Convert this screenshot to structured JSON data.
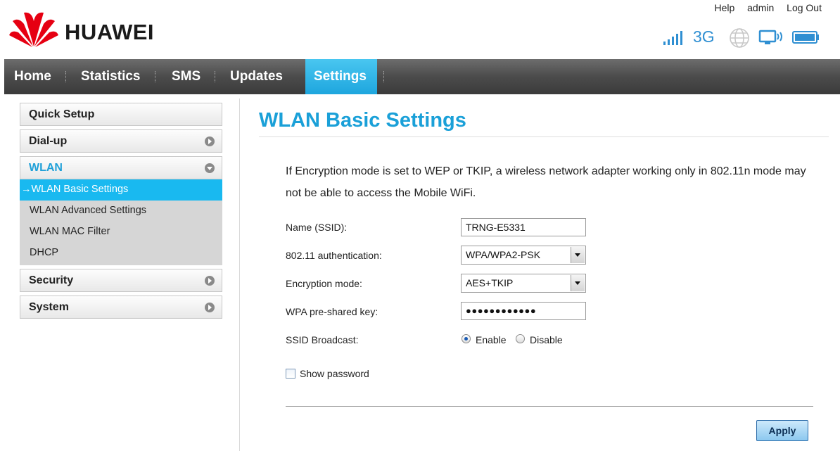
{
  "header": {
    "brand": "HUAWEI",
    "links": {
      "help": "Help",
      "user": "admin",
      "logout": "Log Out"
    },
    "status": {
      "network_type": "3G"
    }
  },
  "nav": {
    "tabs": [
      {
        "label": "Home"
      },
      {
        "label": "Statistics"
      },
      {
        "label": "SMS"
      },
      {
        "label": "Updates"
      },
      {
        "label": "Settings"
      }
    ],
    "active": "Settings"
  },
  "sidebar": {
    "items": [
      {
        "label": "Quick Setup"
      },
      {
        "label": "Dial-up"
      },
      {
        "label": "WLAN"
      },
      {
        "label": "Security"
      },
      {
        "label": "System"
      }
    ],
    "wlan_sub": [
      {
        "label": "→WLAN Basic Settings"
      },
      {
        "label": "WLAN Advanced Settings"
      },
      {
        "label": "WLAN MAC Filter"
      },
      {
        "label": "DHCP"
      }
    ]
  },
  "content": {
    "title": "WLAN Basic Settings",
    "notice": "If Encryption mode is set to WEP or TKIP, a wireless network adapter working only in 802.11n mode may not be able to access the Mobile WiFi.",
    "form": {
      "ssid_label": "Name (SSID):",
      "ssid_value": "TRNG-E5331",
      "auth_label": "802.11 authentication:",
      "auth_value": "WPA/WPA2-PSK",
      "enc_label": "Encryption mode:",
      "enc_value": "AES+TKIP",
      "psk_label": "WPA pre-shared key:",
      "psk_value": "●●●●●●●●●●●●",
      "broadcast_label": "SSID Broadcast:",
      "broadcast_enable": "Enable",
      "broadcast_disable": "Disable",
      "broadcast_selected": "Enable",
      "show_password": "Show password"
    },
    "apply": "Apply"
  },
  "colors": {
    "accent": "#1aa0d8",
    "nav_active": "#1ea6de",
    "sidebar_active": "#19b9f0"
  }
}
